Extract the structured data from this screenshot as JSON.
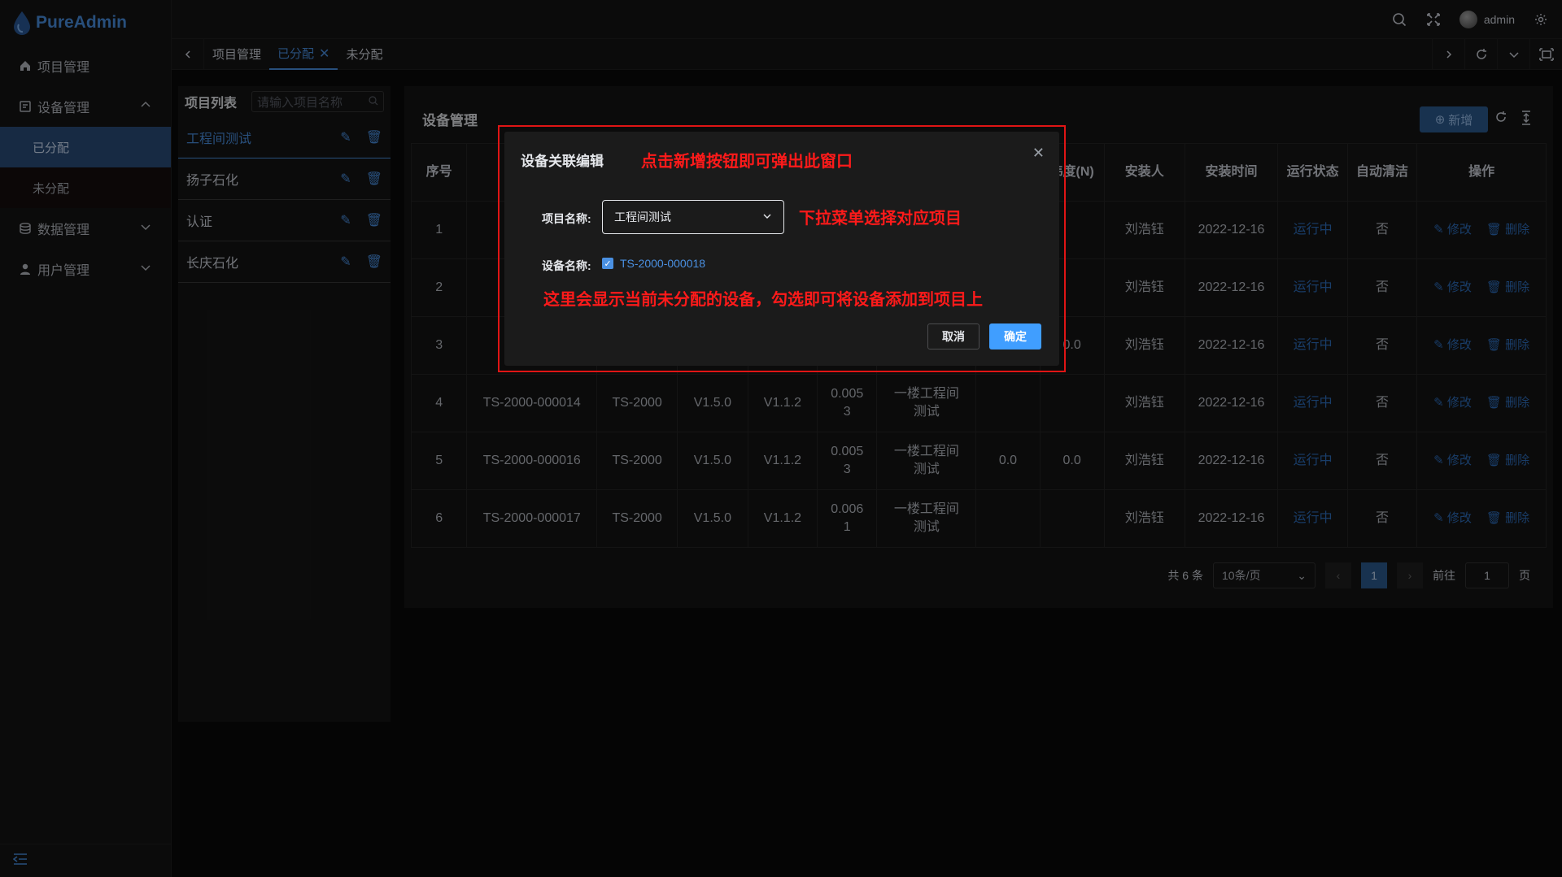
{
  "app": {
    "name": "PureAdmin"
  },
  "header": {
    "user": "admin"
  },
  "sidebar": {
    "items": [
      {
        "label": "项目管理"
      },
      {
        "label": "设备管理"
      },
      {
        "label": "已分配"
      },
      {
        "label": "未分配"
      },
      {
        "label": "数据管理"
      },
      {
        "label": "用户管理"
      }
    ]
  },
  "tabs": [
    {
      "label": "项目管理"
    },
    {
      "label": "已分配"
    },
    {
      "label": "未分配"
    }
  ],
  "project_panel": {
    "title": "项目列表",
    "search_placeholder": "请输入项目名称",
    "items": [
      "工程间测试",
      "扬子石化",
      "认证",
      "长庆石化"
    ]
  },
  "main": {
    "title": "设备管理",
    "add_label": "新增",
    "columns": [
      "序号",
      "",
      "",
      "",
      "",
      "",
      "",
      "",
      "纬度(N)",
      "安装人",
      "安装时间",
      "运行状态",
      "自动清洁",
      "操作"
    ],
    "rows": [
      [
        "1",
        "TS-",
        "",
        "",
        "",
        "",
        "",
        "",
        "",
        "刘浩钰",
        "2022-12-16",
        "运行中",
        "否"
      ],
      [
        "2",
        "TS-",
        "",
        "",
        "",
        "",
        "",
        "",
        "",
        "刘浩钰",
        "2022-12-16",
        "运行中",
        "否"
      ],
      [
        "3",
        "TS-",
        "",
        "",
        "",
        "",
        "",
        "",
        "0.0",
        "刘浩钰",
        "2022-12-16",
        "运行中",
        "否"
      ],
      [
        "4",
        "TS-2000-000014",
        "TS-2000",
        "V1.5.0",
        "V1.1.2",
        "0.005\n3",
        "一楼工程间\n测试",
        "",
        "",
        "刘浩钰",
        "2022-12-16",
        "运行中",
        "否"
      ],
      [
        "5",
        "TS-2000-000016",
        "TS-2000",
        "V1.5.0",
        "V1.1.2",
        "0.005\n3",
        "一楼工程间\n测试",
        "0.0",
        "0.0",
        "刘浩钰",
        "2022-12-16",
        "运行中",
        "否"
      ],
      [
        "6",
        "TS-2000-000017",
        "TS-2000",
        "V1.5.0",
        "V1.1.2",
        "0.006\n1",
        "一楼工程间\n测试",
        "",
        "",
        "刘浩钰",
        "2022-12-16",
        "运行中",
        "否"
      ]
    ],
    "op_edit": "修改",
    "op_delete": "删除"
  },
  "pager": {
    "total": "共 6 条",
    "page_size": "10条/页",
    "current": "1",
    "goto_prefix": "前往",
    "goto_value": "1",
    "goto_suffix": "页"
  },
  "dialog": {
    "title": "设备关联编辑",
    "annotation_1": "点击新增按钮即可弹出此窗口",
    "project_label": "项目名称:",
    "project_value": "工程间测试",
    "annotation_2": "下拉菜单选择对应项目",
    "device_label": "设备名称:",
    "device_value": "TS-2000-000018",
    "annotation_3": "这里会显示当前未分配的设备，勾选即可将设备添加到项目上",
    "cancel": "取消",
    "ok": "确定"
  }
}
